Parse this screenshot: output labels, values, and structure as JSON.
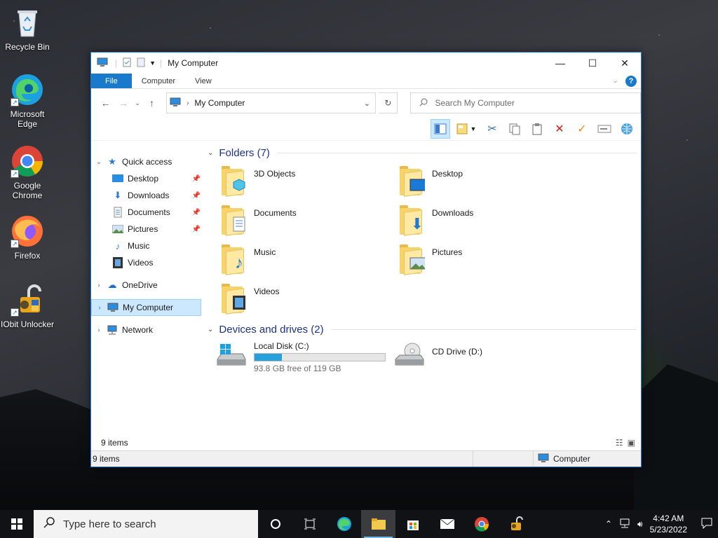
{
  "desktop": {
    "icons": [
      {
        "label": "Recycle Bin"
      },
      {
        "label": "Microsoft Edge"
      },
      {
        "label": "Google Chrome"
      },
      {
        "label": "Firefox"
      },
      {
        "label": "IObit Unlocker"
      }
    ]
  },
  "window": {
    "title": "My Computer",
    "controls": {
      "minimize": "—",
      "maximize": "☐",
      "close": "✕"
    },
    "ribbon_tabs": [
      "File",
      "Computer",
      "View"
    ],
    "address": "My Computer",
    "search_placeholder": "Search My Computer"
  },
  "sidebar": {
    "quick_access": "Quick access",
    "quick_items": [
      "Desktop",
      "Downloads",
      "Documents",
      "Pictures",
      "Music",
      "Videos"
    ],
    "onedrive": "OneDrive",
    "my_computer": "My Computer",
    "network": "Network"
  },
  "content": {
    "folders_header": "Folders (7)",
    "folders": [
      "3D Objects",
      "Desktop",
      "Documents",
      "Downloads",
      "Music",
      "Pictures",
      "Videos"
    ],
    "drives_header": "Devices and drives (2)",
    "drives": [
      {
        "name": "Local Disk (C:)",
        "free": "93.8 GB free of 119 GB",
        "used_fraction": 0.21
      },
      {
        "name": "CD Drive (D:)"
      }
    ]
  },
  "status": {
    "items_count": "9 items",
    "bottom_count": "9 items",
    "location": "Computer"
  },
  "taskbar": {
    "search_placeholder": "Type here to search",
    "time": "4:42 AM",
    "date": "5/23/2022"
  },
  "colors": {
    "accent": "#1979ca",
    "selection": "#cce8ff",
    "drive_bar": "#26a0da"
  }
}
